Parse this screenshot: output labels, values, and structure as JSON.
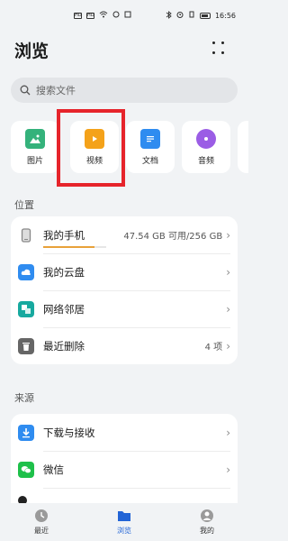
{
  "status_bar": {
    "time": "16:56",
    "signal1": "HD",
    "signal2": "HD"
  },
  "header": {
    "title": "浏览"
  },
  "search": {
    "placeholder": "搜索文件"
  },
  "categories": [
    {
      "label": "图片",
      "icon": "image-icon",
      "color": "#34b27b"
    },
    {
      "label": "视频",
      "icon": "video-icon",
      "color": "#f4a21a"
    },
    {
      "label": "文档",
      "icon": "document-icon",
      "color": "#2f8cf0"
    },
    {
      "label": "音频",
      "icon": "audio-icon",
      "color": "#9b5de5"
    }
  ],
  "location": {
    "label": "位置",
    "items": [
      {
        "label": "我的手机",
        "value": "47.54 GB 可用/256 GB",
        "icon": "phone-icon",
        "storage_used_fraction": 0.81
      },
      {
        "label": "我的云盘",
        "value": "",
        "icon": "cloud-icon"
      },
      {
        "label": "网络邻居",
        "value": "",
        "icon": "network-icon"
      },
      {
        "label": "最近删除",
        "value": "4 项",
        "icon": "trash-icon"
      }
    ]
  },
  "sources": {
    "label": "来源",
    "items": [
      {
        "label": "下载与接收",
        "icon": "download-icon"
      },
      {
        "label": "微信",
        "icon": "wechat-icon"
      }
    ]
  },
  "bottom_nav": [
    {
      "label": "最近",
      "icon": "clock-icon"
    },
    {
      "label": "浏览",
      "icon": "folder-icon"
    },
    {
      "label": "我的",
      "icon": "profile-icon"
    }
  ],
  "colors": {
    "accent": "#2264d6",
    "highlight_box": "#e6242b"
  }
}
